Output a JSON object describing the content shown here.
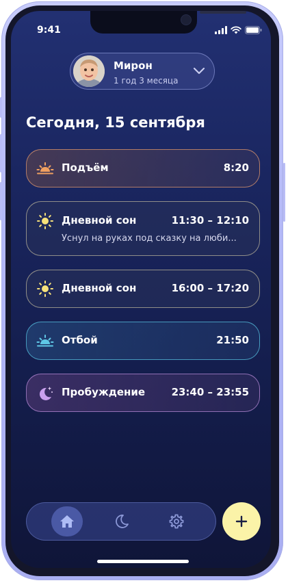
{
  "status_bar": {
    "time": "9:41"
  },
  "profile": {
    "name": "Мирон",
    "age": "1 год 3 месяца"
  },
  "page_title": "Сегодня, 15 сентября",
  "events": [
    {
      "title": "Подъём",
      "time": "8:20",
      "icon": "sunrise-icon"
    },
    {
      "title": "Дневной сон",
      "time": "11:30 – 12:10",
      "note": "Уснул на руках под сказку на люби...",
      "icon": "sun-icon"
    },
    {
      "title": "Дневной сон",
      "time": "16:00 – 17:20",
      "icon": "sun-icon"
    },
    {
      "title": "Отбой",
      "time": "21:50",
      "icon": "sunset-icon"
    },
    {
      "title": "Пробуждение",
      "time": "23:40 – 23:55",
      "icon": "moon-stars-icon"
    }
  ],
  "nav": {
    "items": [
      {
        "name": "home",
        "icon": "home-icon",
        "active": true
      },
      {
        "name": "sleep",
        "icon": "moon-icon",
        "active": false
      },
      {
        "name": "settings",
        "icon": "gear-icon",
        "active": false
      }
    ],
    "add_icon": "plus-icon"
  },
  "colors": {
    "background_top": "#223072",
    "background_bottom": "#0f1538",
    "wake_accent": "#f0a060",
    "sun_accent": "#f7e27a",
    "bedtime_accent": "#5fc8e6",
    "night_accent": "#c9a0ee",
    "fab": "#fbf3a8"
  }
}
